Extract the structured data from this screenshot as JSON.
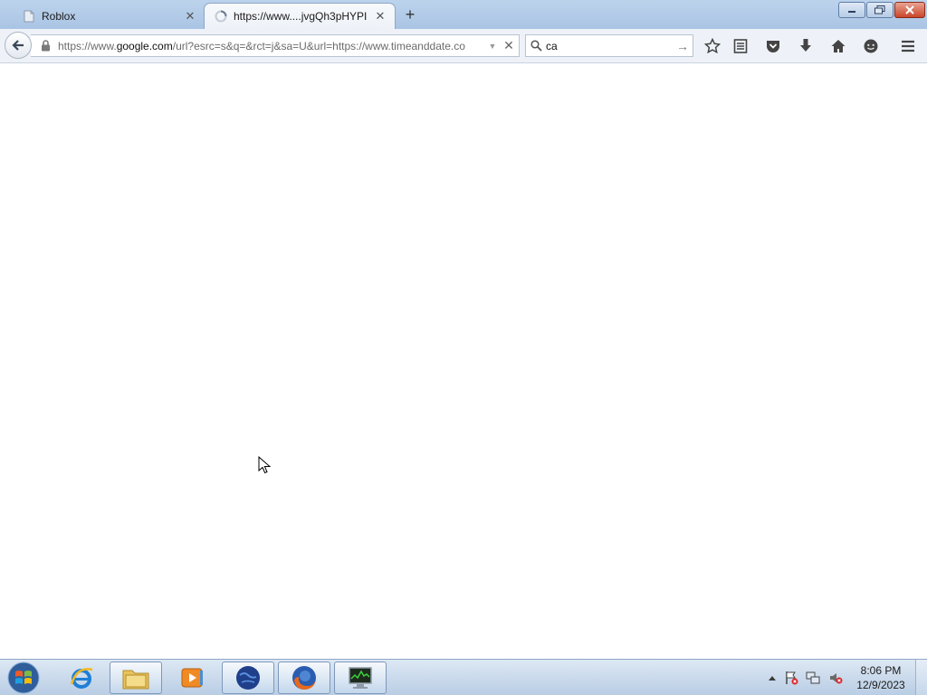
{
  "browser": {
    "tabs": [
      {
        "label": "Roblox",
        "icon": "page-icon",
        "active": false
      },
      {
        "label": "https://www....jvgQh3pHYPI",
        "icon": "loading-icon",
        "active": true
      }
    ],
    "new_tab": "+",
    "window_controls": {
      "minimize": "minimize-icon",
      "maximize": "restore-icon",
      "close": "close-icon"
    }
  },
  "navbar": {
    "url_prefix": "https://www.",
    "url_host": "google.com",
    "url_rest": "/url?esrc=s&q=&rct=j&sa=U&url=https://www.timeanddate.co",
    "search_value": "ca",
    "toolbar_icons": [
      "bookmark-star-icon",
      "reading-list-icon",
      "pocket-icon",
      "downloads-icon",
      "home-icon",
      "hello-icon",
      "menu-icon"
    ]
  },
  "content": {
    "state": "blank-loading"
  },
  "taskbar": {
    "items": [
      {
        "name": "internet-explorer-icon",
        "active": false
      },
      {
        "name": "file-explorer-icon",
        "active": true
      },
      {
        "name": "media-player-icon",
        "active": false
      },
      {
        "name": "browser-globe-icon",
        "active": true
      },
      {
        "name": "firefox-icon",
        "active": true
      },
      {
        "name": "task-monitor-icon",
        "active": true
      }
    ],
    "tray_icons": [
      "show-hidden-icons-arrow",
      "action-center-flag-icon",
      "network-icon",
      "volume-muted-icon"
    ],
    "clock": {
      "time": "8:06 PM",
      "date": "12/9/2023"
    }
  },
  "colors": {
    "titlebar": "#bcd3ec",
    "navbar": "#eef2f8",
    "taskbar": "#c6d7ea",
    "close_button": "#c9452b"
  }
}
